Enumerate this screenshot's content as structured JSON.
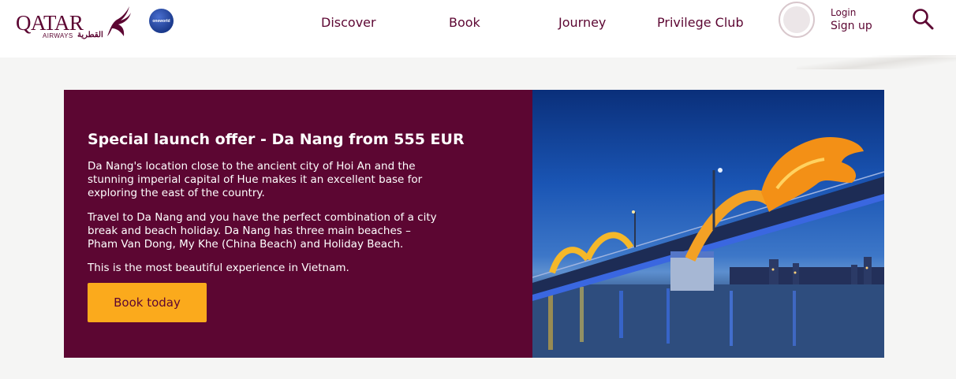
{
  "brand": {
    "name": "QATAR",
    "sub": "AIRWAYS",
    "arabic": "القطرية",
    "alliance": "oneworld"
  },
  "nav": {
    "items": [
      {
        "label": "Discover"
      },
      {
        "label": "Book"
      },
      {
        "label": "Journey"
      },
      {
        "label": "Privilege Club"
      }
    ]
  },
  "account": {
    "login": "Login",
    "signup": "Sign up"
  },
  "promo": {
    "title": "Special launch offer - Da Nang from 555 EUR",
    "paragraphs": [
      "Da Nang's location close to the ancient city of Hoi An and the stunning imperial capital of Hue makes it an excellent base for exploring the east of the country.",
      "Travel to Da Nang and you have the perfect combination of a city break and beach holiday. Da Nang has three main beaches – Pham Van Dong, My Khe (China Beach) and Holiday Beach.",
      "This is the most beautiful experience in Vietnam."
    ],
    "button": "Book today"
  },
  "colors": {
    "brand": "#5c0632",
    "button": "#fbaa1c",
    "background": "#f5f5f4"
  },
  "icons": [
    "oryx-logo-icon",
    "oneworld-icon",
    "avatar-icon",
    "search-icon"
  ]
}
